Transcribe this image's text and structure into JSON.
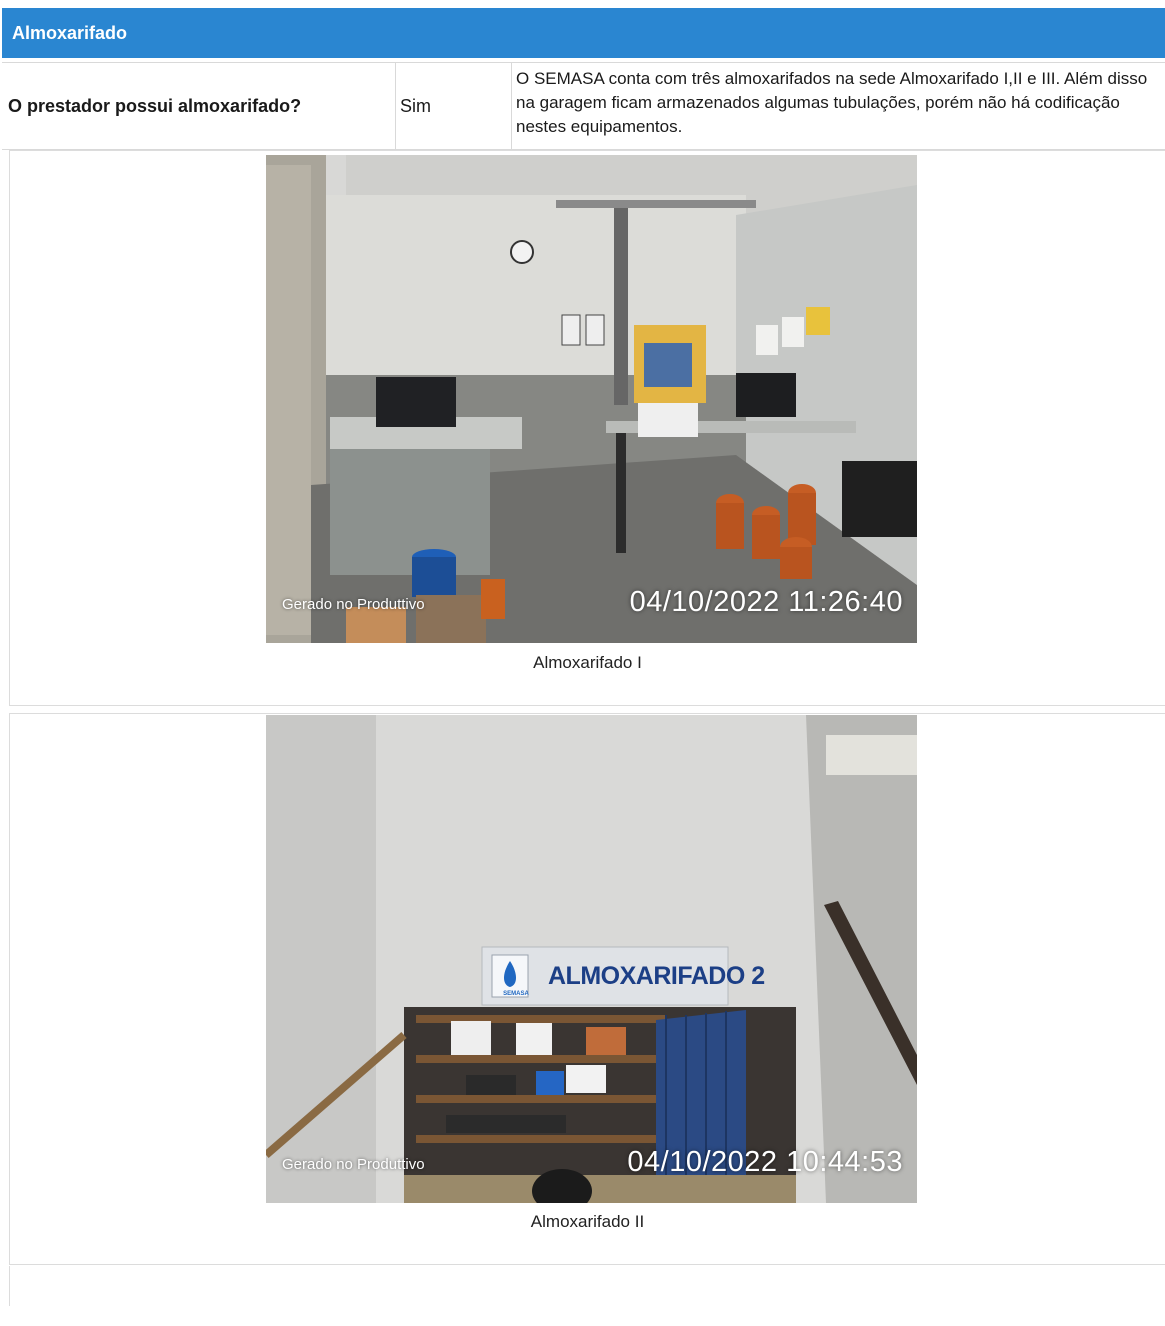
{
  "section": {
    "title": "Almoxarifado"
  },
  "question": {
    "label": "O prestador possui almoxarifado?",
    "answer": "Sim",
    "comment": "O SEMASA conta com três almoxarifados na sede Almoxarifado I,II e III. Além disso na garagem ficam armazenados algumas tubulações, porém não há codificação nestes equipamentos."
  },
  "photos": [
    {
      "overlay_left": "Gerado no Produttivo",
      "timestamp": "04/10/2022 11:26:40",
      "caption": "Almoxarifado I"
    },
    {
      "overlay_left": "Gerado no Produttivo",
      "timestamp": "04/10/2022 10:44:53",
      "caption": "Almoxarifado II",
      "sign_text": "ALMOXARIFADO 2",
      "sign_logo_text": "SEMASA"
    }
  ]
}
